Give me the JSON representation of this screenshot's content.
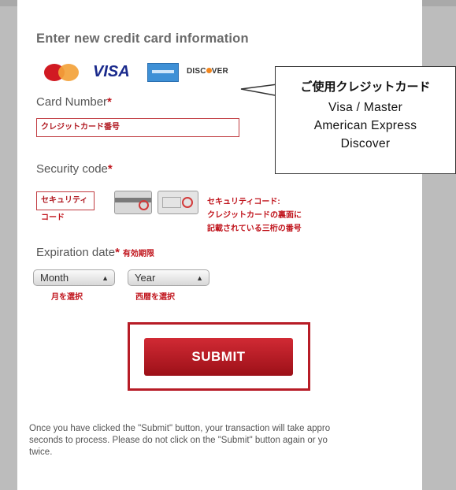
{
  "form": {
    "heading": "Enter new credit card information",
    "card_brands": [
      "mastercard",
      "VISA",
      "american-express",
      "DISCOVER"
    ],
    "visa_text": "VISA",
    "discover_text_a": "DISC",
    "discover_text_b": "VER",
    "card_number_label": "Card Number",
    "required_mark": "*",
    "card_number_placeholder": "クレジットカード番号",
    "security_code_label": "Security code",
    "security_code_placeholder": "セキュリティ",
    "security_code_sub": "コード",
    "security_help_lines": [
      "セキュリティコード:",
      "クレジットカードの裏面に",
      "記載されている三桁の番号"
    ],
    "expiration_label": "Expiration date",
    "expiration_jp": "有効期限",
    "month_select": {
      "selected": "Month",
      "caption": "月を選択"
    },
    "year_select": {
      "selected": "Year",
      "caption": "西暦を選択"
    },
    "submit_label": "SUBMIT",
    "notice_lines": [
      "Once you have clicked the \"Submit\" button, your transaction will take appro",
      "seconds to process. Please do not click on the \"Submit\" button again or yo",
      "twice."
    ]
  },
  "callout": {
    "title": "ご使用クレジットカード",
    "lines": [
      "Visa  /  Master",
      "American Express",
      "Discover"
    ]
  },
  "colors": {
    "accent_red": "#c0141c",
    "submit_gradient_top": "#d12a34",
    "submit_gradient_bottom": "#9c1018",
    "page_background": "#bcbcbc"
  },
  "icons": {
    "select_arrow": "up-down-arrow-icon",
    "card_back_icon": "card-back-icon",
    "card_front_icon": "card-front-icon"
  }
}
